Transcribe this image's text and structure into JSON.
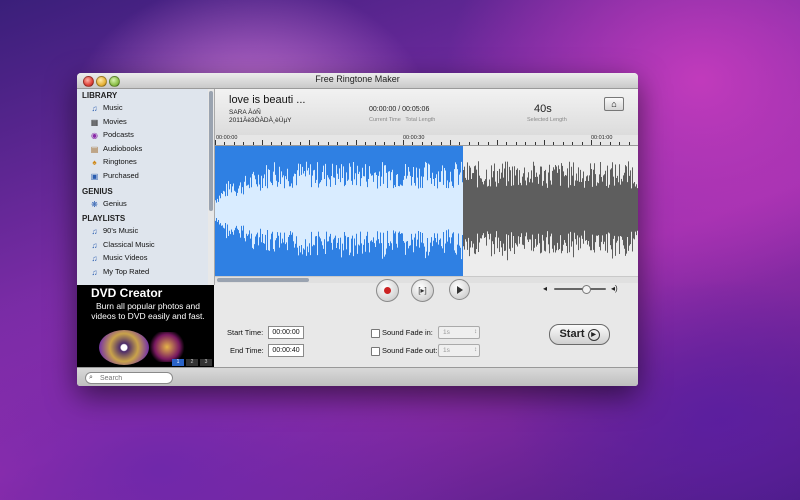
{
  "window": {
    "title": "Free Ringtone Maker"
  },
  "sidebar": {
    "sections": [
      {
        "title": "LIBRARY",
        "items": [
          {
            "label": "Music",
            "icon": "music-note-icon"
          },
          {
            "label": "Movies",
            "icon": "film-icon"
          },
          {
            "label": "Podcasts",
            "icon": "podcast-icon"
          },
          {
            "label": "Audiobooks",
            "icon": "audiobook-icon"
          },
          {
            "label": "Ringtones",
            "icon": "bell-icon"
          },
          {
            "label": "Purchased",
            "icon": "purchased-icon"
          }
        ]
      },
      {
        "title": "GENIUS",
        "items": [
          {
            "label": "Genius",
            "icon": "genius-icon"
          }
        ]
      },
      {
        "title": "PLAYLISTS",
        "items": [
          {
            "label": "90's Music",
            "icon": "playlist-icon"
          },
          {
            "label": "Classical Music",
            "icon": "playlist-icon"
          },
          {
            "label": "Music Videos",
            "icon": "playlist-icon"
          },
          {
            "label": "My Top Rated",
            "icon": "playlist-icon"
          }
        ]
      }
    ]
  },
  "ad": {
    "title": "DVD Creator",
    "text": "Burn all popular photos and videos to DVD easily and fast.",
    "pages": [
      "1",
      "2",
      "3"
    ],
    "active_page": 1
  },
  "song": {
    "title": "love is beauti ...",
    "artist": "SARA ÀóÑ",
    "album": "2011Àè3ÒÀDÀ¸èÙµY",
    "current_time": "00:00:00",
    "total_length": "00:05:06",
    "current_time_label": "Current Time",
    "total_length_label": "Total Length",
    "selected_length": "40s",
    "selected_length_label": "Selected Length"
  },
  "ruler": {
    "labels": [
      "00:00:00",
      "00:00:30",
      "00:01:00"
    ]
  },
  "controls": {
    "volume_level": 0.62
  },
  "form": {
    "start_time_label": "Start Time:",
    "start_time": "00:00:00",
    "end_time_label": "End Time:",
    "end_time": "00:00:40",
    "fade_in_label": "Sound Fade in:",
    "fade_in_value": "1s",
    "fade_out_label": "Sound Fade out:",
    "fade_out_value": "1s",
    "start_button": "Start"
  },
  "search": {
    "placeholder": "Search"
  },
  "colors": {
    "selection": "#2f80e3",
    "waveform_selected": "#d9ecff",
    "waveform_unselected": "#5e5e5e"
  }
}
